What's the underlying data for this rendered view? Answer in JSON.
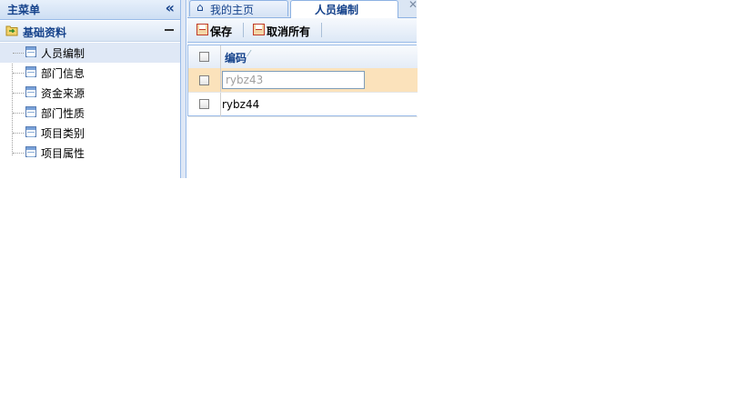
{
  "menu": {
    "title": "主菜单",
    "collapse_icon": "double-chevron-left-icon",
    "section": {
      "title": "基础资料",
      "icon": "folder-icon",
      "toggle_icon": "minus-icon"
    },
    "items": [
      {
        "label": "人员编制",
        "selected": true
      },
      {
        "label": "部门信息"
      },
      {
        "label": "资金来源"
      },
      {
        "label": "部门性质"
      },
      {
        "label": "项目类别"
      },
      {
        "label": "项目属性"
      }
    ]
  },
  "tabs": [
    {
      "label": "我的主页",
      "icon": "home-icon",
      "active": false
    },
    {
      "label": "人员编制",
      "active": true,
      "close_icon": "close-icon"
    }
  ],
  "toolbar": {
    "save_label": "保存",
    "cancel_all_label": "取消所有"
  },
  "grid": {
    "columns": [
      {
        "label": "编码"
      }
    ],
    "rows": [
      {
        "value": "rybz43",
        "editing": true
      },
      {
        "value": "rybz44",
        "editing": false
      }
    ]
  },
  "colors": {
    "header_text": "#15428b",
    "border": "#99bbe8",
    "selected_row": "#dfe8f6",
    "editing_row": "#fbe2bb"
  }
}
